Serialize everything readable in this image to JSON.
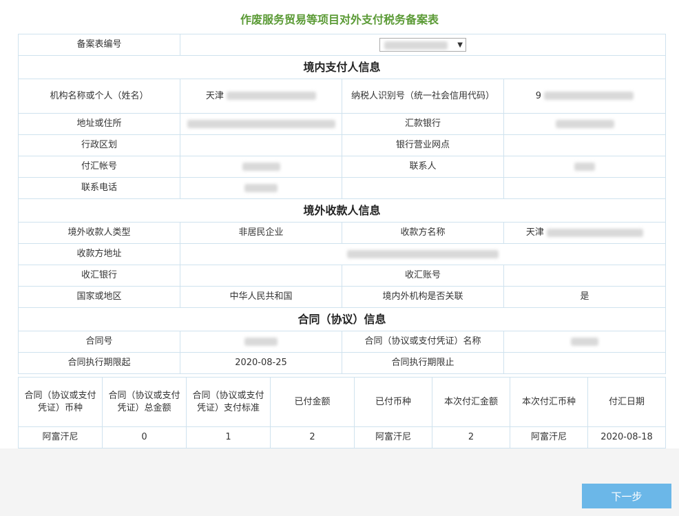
{
  "title": "作废服务贸易等项目对外支付税务备案表",
  "form": {
    "record_no_label": "备案表编号",
    "domestic_section": "境内支付人信息",
    "org_name_label": "机构名称或个人（姓名）",
    "org_name_value": "天津",
    "taxpayer_id_label": "纳税人识别号（统一社会信用代码）",
    "taxpayer_id_value": "9",
    "address_label": "地址或住所",
    "remit_bank_label": "汇款银行",
    "admin_region_label": "行政区划",
    "bank_branch_label": "银行营业网点",
    "payment_account_label": "付汇帐号",
    "contact_label": "联系人",
    "phone_label": "联系电话",
    "overseas_section": "境外收款人信息",
    "payee_type_label": "境外收款人类型",
    "payee_type_value": "非居民企业",
    "payee_name_label": "收款方名称",
    "payee_name_value": "天津",
    "payee_address_label": "收款方地址",
    "receiving_bank_label": "收汇银行",
    "receiving_account_label": "收汇账号",
    "country_label": "国家或地区",
    "country_value": "中华人民共和国",
    "related_label": "境内外机构是否关联",
    "related_value": "是",
    "contract_section": "合同（协议）信息",
    "contract_no_label": "合同号",
    "contract_name_label": "合同（协议或支付凭证）名称",
    "start_date_label": "合同执行期限起",
    "start_date_value": "2020-08-25",
    "end_date_label": "合同执行期限止"
  },
  "payment_table": {
    "headers": [
      "合同（协议或支付凭证）币种",
      "合同（协议或支付凭证）总金额",
      "合同（协议或支付凭证）支付标准",
      "已付金额",
      "已付币种",
      "本次付汇金额",
      "本次付汇币种",
      "付汇日期"
    ],
    "rows": [
      [
        "阿富汗尼",
        "0",
        "1",
        "2",
        "阿富汗尼",
        "2",
        "阿富汗尼",
        "2020-08-18"
      ]
    ]
  },
  "next_button": "下一步"
}
